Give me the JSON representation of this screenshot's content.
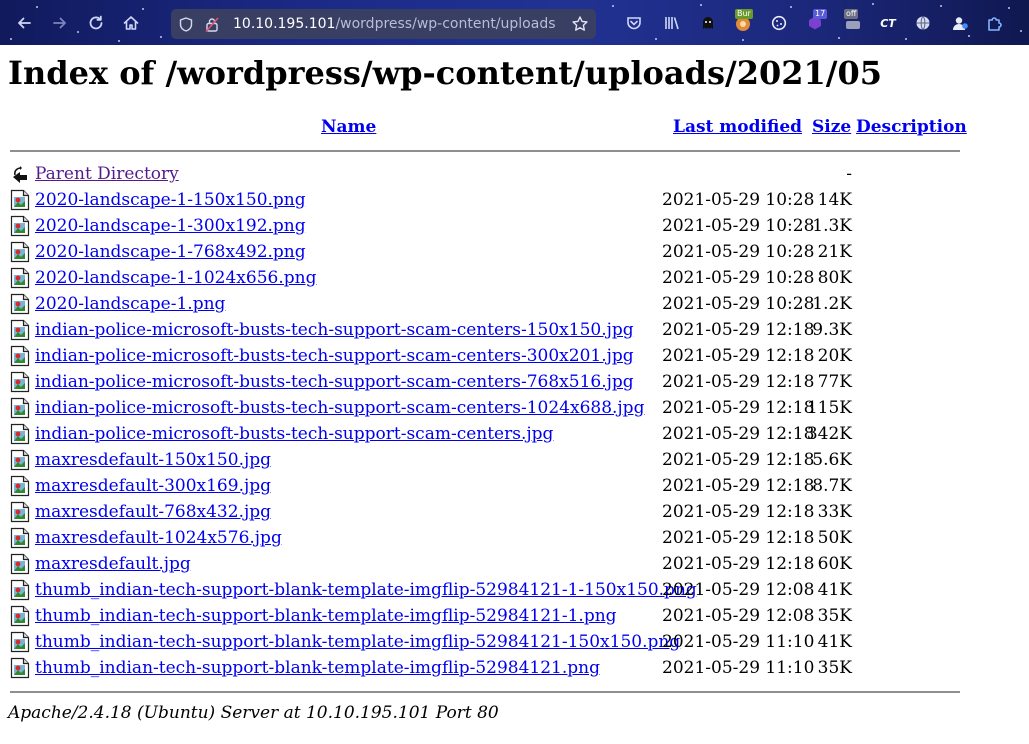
{
  "browser": {
    "url_host": "10.10.195.101",
    "url_path": "/wordpress/wp-content/uploads/",
    "extensions": [
      {
        "name": "pocket-icon"
      },
      {
        "name": "library-icon"
      },
      {
        "name": "extension-ghost-icon"
      },
      {
        "name": "burp-proxy-icon",
        "badge": "Bur"
      },
      {
        "name": "cookie-icon"
      },
      {
        "name": "extension-badge-icon",
        "badge": "17"
      },
      {
        "name": "off-toggle-icon",
        "badge": "off"
      },
      {
        "name": "extension-ct-icon",
        "label": "CT"
      },
      {
        "name": "extension-globe-icon"
      },
      {
        "name": "extension-user-icon"
      },
      {
        "name": "extensions-puzzle-icon"
      }
    ]
  },
  "page": {
    "title": "Index of /wordpress/wp-content/uploads/2021/05",
    "columns": {
      "name": "Name",
      "last_modified": "Last modified",
      "size": "Size",
      "description": "Description"
    },
    "parent": {
      "name": "Parent Directory",
      "date": "",
      "size": "-"
    },
    "files": [
      {
        "name": "2020-landscape-1-150x150.png",
        "date": "2021-05-29 10:28",
        "size": "14K"
      },
      {
        "name": "2020-landscape-1-300x192.png",
        "date": "2021-05-29 10:28",
        "size": "1.3K"
      },
      {
        "name": "2020-landscape-1-768x492.png",
        "date": "2021-05-29 10:28",
        "size": "21K"
      },
      {
        "name": "2020-landscape-1-1024x656.png",
        "date": "2021-05-29 10:28",
        "size": "80K"
      },
      {
        "name": "2020-landscape-1.png",
        "date": "2021-05-29 10:28",
        "size": "1.2K"
      },
      {
        "name": "indian-police-microsoft-busts-tech-support-scam-centers-150x150.jpg",
        "date": "2021-05-29 12:18",
        "size": "9.3K"
      },
      {
        "name": "indian-police-microsoft-busts-tech-support-scam-centers-300x201.jpg",
        "date": "2021-05-29 12:18",
        "size": "20K"
      },
      {
        "name": "indian-police-microsoft-busts-tech-support-scam-centers-768x516.jpg",
        "date": "2021-05-29 12:18",
        "size": "77K"
      },
      {
        "name": "indian-police-microsoft-busts-tech-support-scam-centers-1024x688.jpg",
        "date": "2021-05-29 12:18",
        "size": "115K"
      },
      {
        "name": "indian-police-microsoft-busts-tech-support-scam-centers.jpg",
        "date": "2021-05-29 12:18",
        "size": "342K"
      },
      {
        "name": "maxresdefault-150x150.jpg",
        "date": "2021-05-29 12:18",
        "size": "5.6K"
      },
      {
        "name": "maxresdefault-300x169.jpg",
        "date": "2021-05-29 12:18",
        "size": "8.7K"
      },
      {
        "name": "maxresdefault-768x432.jpg",
        "date": "2021-05-29 12:18",
        "size": "33K"
      },
      {
        "name": "maxresdefault-1024x576.jpg",
        "date": "2021-05-29 12:18",
        "size": "50K"
      },
      {
        "name": "maxresdefault.jpg",
        "date": "2021-05-29 12:18",
        "size": "60K"
      },
      {
        "name": "thumb_indian-tech-support-blank-template-imgflip-52984121-1-150x150.png",
        "date": "2021-05-29 12:08",
        "size": "41K"
      },
      {
        "name": "thumb_indian-tech-support-blank-template-imgflip-52984121-1.png",
        "date": "2021-05-29 12:08",
        "size": "35K"
      },
      {
        "name": "thumb_indian-tech-support-blank-template-imgflip-52984121-150x150.png",
        "date": "2021-05-29 11:10",
        "size": "41K"
      },
      {
        "name": "thumb_indian-tech-support-blank-template-imgflip-52984121.png",
        "date": "2021-05-29 11:10",
        "size": "35K"
      }
    ],
    "footer": "Apache/2.4.18 (Ubuntu) Server at 10.10.195.101 Port 80"
  },
  "colors": {
    "link": "#0000ee",
    "visited": "#551a8b",
    "toolbar": "#1c2a86"
  }
}
